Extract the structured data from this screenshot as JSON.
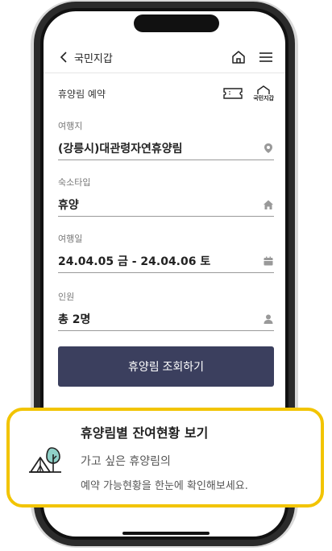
{
  "header": {
    "back_label": "국민지갑",
    "home_icon": "home-icon",
    "menu_icon": "hamburger-menu-icon"
  },
  "section": {
    "title": "휴양림 예약",
    "brand_text": "국민지갑"
  },
  "form": {
    "destination": {
      "label": "여행지",
      "value": "(강릉시)대관령자연휴양림",
      "icon": "location-pin-icon"
    },
    "lodging": {
      "label": "숙소타입",
      "value": "휴양",
      "icon": "house-icon"
    },
    "dates": {
      "label": "여행일",
      "value": "24.04.05 금 - 24.04.06 토",
      "icon": "calendar-icon"
    },
    "guests": {
      "label": "인원",
      "value": "총 2명",
      "icon": "person-icon"
    }
  },
  "search_button": {
    "label": "휴양림 조회하기"
  },
  "callout": {
    "title": "휴양림별 잔여현황 보기",
    "desc_line1": "가고 싶은 휴양림의",
    "desc_line2": "예약 가능현황을 한눈에 확인해보세요.",
    "accent_color": "#f2c400"
  },
  "colors": {
    "button_bg": "#3b3f5e",
    "callout_border": "#f2c400"
  }
}
